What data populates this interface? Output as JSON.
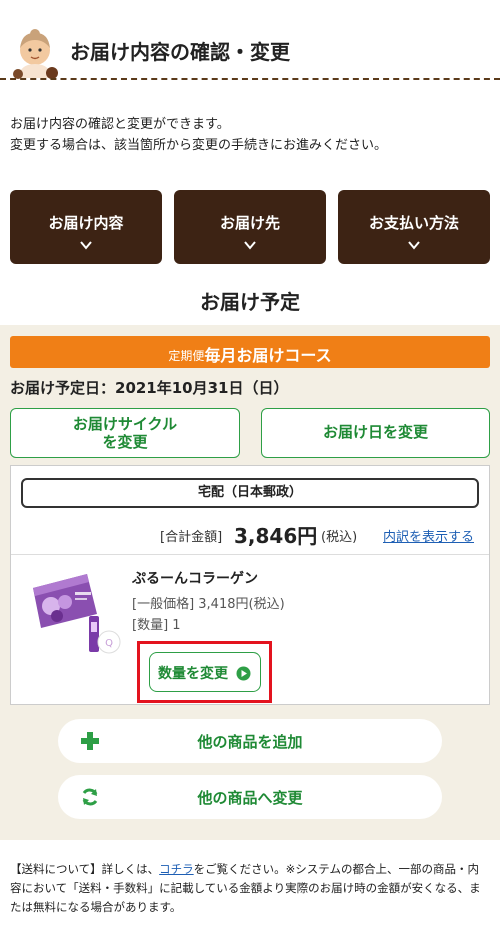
{
  "header": {
    "title": "お届け内容の確認・変更"
  },
  "intro": {
    "line1": "お届け内容の確認と変更ができます。",
    "line2": "変更する場合は、該当箇所から変更の手続きにお進みください。"
  },
  "nav": {
    "items": [
      {
        "label": "お届け内容"
      },
      {
        "label": "お届け先"
      },
      {
        "label": "お支払い方法"
      }
    ]
  },
  "schedule": {
    "title": "お届け予定",
    "course_prefix": "定期便",
    "course_name": "毎月お届けコース",
    "delivery_date": "お届け予定日：2021年10月31日（日）",
    "change_cycle_line1": "お届けサイクル",
    "change_cycle_line2": "を変更",
    "change_date": "お届け日を変更"
  },
  "order": {
    "carrier": "宅配（日本郵政）",
    "total_label": "[合計金額]",
    "total_value": "3,846円",
    "tax_label": "(税込)",
    "breakdown_link": "内訳を表示する"
  },
  "product": {
    "name": "ぷるーんコラーゲン",
    "price_text": "[一般価格] 3,418円(税込)",
    "quantity_text": "[数量] 1",
    "change_qty_label": "数量を変更"
  },
  "actions": {
    "add_label": "他の商品を追加",
    "change_label": "他の商品へ変更"
  },
  "footnote": {
    "prefix": "【送料について】詳しくは、",
    "link": "コチラ",
    "suffix": "をご覧ください。※システムの都合上、一部の商品・内容において「送料・手数料」に記載している金額より実際のお届け時の金額が安くなる、または無料になる場合があります。"
  },
  "colors": {
    "nav_bg": "#3d2314",
    "course_orange": "#f07f16",
    "green": "#1f8a35",
    "panel_bg": "#f3efe4",
    "highlight_red": "#e3131e",
    "link_blue": "#1e5fb4"
  }
}
